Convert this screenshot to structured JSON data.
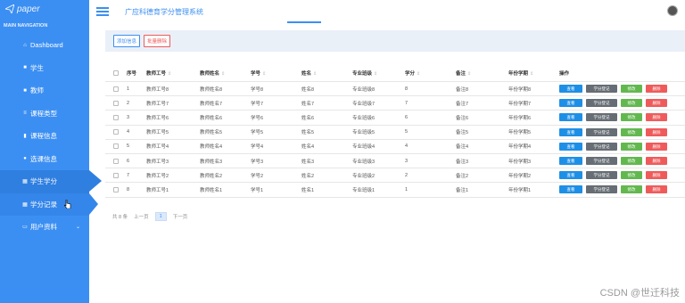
{
  "app": {
    "logo_text": "paper",
    "title": "广应科德育学分管理系统"
  },
  "sidebar": {
    "header": "MAIN NAVIGATION",
    "items": [
      {
        "label": "Dashboard",
        "icon": "home-icon"
      },
      {
        "label": "学生",
        "icon": "square-icon"
      },
      {
        "label": "教师",
        "icon": "square-icon"
      },
      {
        "label": "课程类型",
        "icon": "list-icon"
      },
      {
        "label": "课程信息",
        "icon": "bar-chart-icon"
      },
      {
        "label": "选课信息",
        "icon": "pin-icon"
      },
      {
        "label": "学生学分",
        "icon": "grid-icon"
      },
      {
        "label": "学分记录",
        "icon": "grid-icon"
      },
      {
        "label": "用户资料",
        "icon": "card-icon"
      }
    ]
  },
  "toolbar": {
    "add_label": "添加信息",
    "delete_label": "批量删除"
  },
  "table": {
    "headers": [
      "序号",
      "教师工号",
      "教师姓名",
      "学号",
      "姓名",
      "专业班级",
      "学分",
      "备注",
      "年份学期",
      "操作"
    ],
    "rows": [
      [
        "1",
        "教师工号8",
        "教师姓名8",
        "学号8",
        "姓名8",
        "专业班级8",
        "8",
        "备注8",
        "年份学期8"
      ],
      [
        "2",
        "教师工号7",
        "教师姓名7",
        "学号7",
        "姓名7",
        "专业班级7",
        "7",
        "备注7",
        "年份学期7"
      ],
      [
        "3",
        "教师工号6",
        "教师姓名6",
        "学号6",
        "姓名6",
        "专业班级6",
        "6",
        "备注6",
        "年份学期6"
      ],
      [
        "4",
        "教师工号5",
        "教师姓名5",
        "学号5",
        "姓名5",
        "专业班级5",
        "5",
        "备注5",
        "年份学期5"
      ],
      [
        "5",
        "教师工号4",
        "教师姓名4",
        "学号4",
        "姓名4",
        "专业班级4",
        "4",
        "备注4",
        "年份学期4"
      ],
      [
        "6",
        "教师工号3",
        "教师姓名3",
        "学号3",
        "姓名3",
        "专业班级3",
        "3",
        "备注3",
        "年份学期3"
      ],
      [
        "7",
        "教师工号2",
        "教师姓名2",
        "学号2",
        "姓名2",
        "专业班级2",
        "2",
        "备注2",
        "年份学期2"
      ],
      [
        "8",
        "教师工号1",
        "教师姓名1",
        "学号1",
        "姓名1",
        "专业班级1",
        "1",
        "备注1",
        "年份学期1"
      ]
    ],
    "ops": {
      "view": "查看",
      "register": "学分登记",
      "edit": "修改",
      "delete": "删除"
    },
    "sort_glyph": "⇳"
  },
  "pager": {
    "total": "共 8 条",
    "prev": "上一页",
    "current": "1",
    "next": "下一页"
  },
  "watermark": "CSDN @世迁科技",
  "colors": {
    "sidebar": "#3c8ff2",
    "view": "#1e8fe6",
    "register": "#666d74",
    "edit": "#62b84f",
    "delete": "#ef5b5b"
  }
}
